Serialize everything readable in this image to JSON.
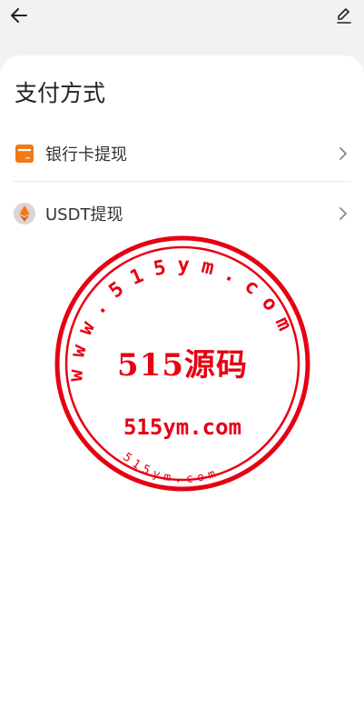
{
  "header": {
    "back_icon": "arrow-left-icon",
    "edit_icon": "pencil-icon"
  },
  "page": {
    "title": "支付方式"
  },
  "methods": [
    {
      "label": "银行卡提现",
      "icon": "bank-card-icon",
      "accent": "#f07a1a"
    },
    {
      "label": "USDT提现",
      "icon": "ethereum-icon",
      "accent": "#f07a1a"
    }
  ],
  "watermark": {
    "ring_text": "www.515ym.com",
    "center_text": "515源码",
    "url_text": "515ym.com",
    "bottom_text": "515ym.com",
    "color": "#e60012"
  }
}
